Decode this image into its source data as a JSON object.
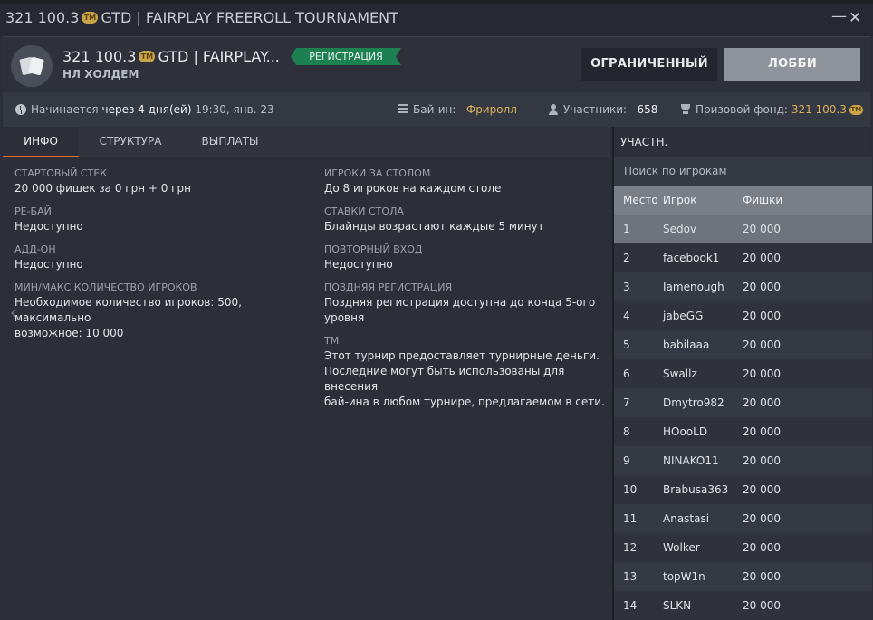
{
  "window": {
    "title_amount": "321 100.3",
    "title_coin": "TM",
    "title_text": "GTD | FAIRPLAY FREEROLL TOURNAMENT",
    "minimize": "—",
    "close": "✕"
  },
  "header": {
    "amount": "321 100.3",
    "coin": "TM",
    "name": "GTD | FAIRPLAY...",
    "game_type": "НЛ ХОЛДЕМ",
    "status": "РЕГИСТРАЦИЯ",
    "limited_button": "ОГРАНИЧЕННЫЙ",
    "lobby_button": "ЛОББИ"
  },
  "infobar": {
    "starts_label": "Начинается",
    "starts_in": "через 4 дня(ей)",
    "starts_time": "19:30, янв. 23",
    "buyin_label": "Бай-ин:",
    "buyin_value": "Фриролл",
    "players_label": "Участники:",
    "players_value": "658",
    "prize_label": "Призовой фонд:",
    "prize_value": "321 100.3",
    "prize_coin": "TM"
  },
  "tabs": {
    "info": "ИНФО",
    "structure": "СТРУКТУРА",
    "payouts": "ВЫПЛАТЫ"
  },
  "info": {
    "start_stack_label": "СТАРТОВЫЙ СТЕК",
    "start_stack_value": "20 000 фишек за 0 грн + 0 грн",
    "rebuy_label": "РЕ-БАЙ",
    "rebuy_value": "Недоступно",
    "addon_label": "АДД-ОН",
    "addon_value": "Недоступно",
    "minmax_label": "МИН/МАКС КОЛИЧЕСТВО ИГРОКОВ",
    "minmax_value_1": "Необходимое количество игроков: 500, максимально",
    "minmax_value_2": "возможное: 10 000",
    "per_table_label": "ИГРОКИ ЗА СТОЛОМ",
    "per_table_value": "До 8 игроков на каждом столе",
    "stakes_label": "СТАВКИ СТОЛА",
    "stakes_value": "Блайнды возрастают каждые 5 минут",
    "reentry_label": "ПОВТОРНЫЙ ВХОД",
    "reentry_value": "Недоступно",
    "late_reg_label": "ПОЗДНЯЯ РЕГИСТРАЦИЯ",
    "late_reg_value_1": "Поздняя регистрация доступна до конца 5-ого",
    "late_reg_value_2": "уровня",
    "tm_label": "TM",
    "tm_value_1": "Этот турнир предоставляет турнирные деньги.",
    "tm_value_2": "Последние могут быть использованы для внесения",
    "tm_value_3": "бай-ина в любом турнире, предлагаемом в сети."
  },
  "players_panel": {
    "title": "УЧАСТН.",
    "search_placeholder": "Поиск по игрокам",
    "col_place": "Место",
    "col_player": "Игрок",
    "col_chips": "Фишки",
    "rows": [
      {
        "place": "1",
        "name": "Sedov",
        "chips": "20 000"
      },
      {
        "place": "2",
        "name": "facebook1",
        "chips": "20 000"
      },
      {
        "place": "3",
        "name": "Iamenough",
        "chips": "20 000"
      },
      {
        "place": "4",
        "name": "jabeGG",
        "chips": "20 000"
      },
      {
        "place": "5",
        "name": "babilaaa",
        "chips": "20 000"
      },
      {
        "place": "6",
        "name": "Swallz",
        "chips": "20 000"
      },
      {
        "place": "7",
        "name": "Dmytro982",
        "chips": "20 000"
      },
      {
        "place": "8",
        "name": "HOooLD",
        "chips": "20 000"
      },
      {
        "place": "9",
        "name": "NINAKO11",
        "chips": "20 000"
      },
      {
        "place": "10",
        "name": "Brabusa363",
        "chips": "20 000"
      },
      {
        "place": "11",
        "name": "Anastasi",
        "chips": "20 000"
      },
      {
        "place": "12",
        "name": "Wolker",
        "chips": "20 000"
      },
      {
        "place": "13",
        "name": "topW1n",
        "chips": "20 000"
      },
      {
        "place": "14",
        "name": "SLKN",
        "chips": "20 000"
      }
    ]
  },
  "icons": {
    "clock": "clock-icon",
    "buyin": "chip-stack-icon",
    "players": "user-icon",
    "prize": "trophy-icon",
    "game": "cards-icon",
    "carousel_prev": "chevron-left-icon"
  },
  "colors": {
    "accent_tab": "#e46a2a",
    "status_badge": "#1d8050",
    "gold_text": "#d9b15a"
  }
}
